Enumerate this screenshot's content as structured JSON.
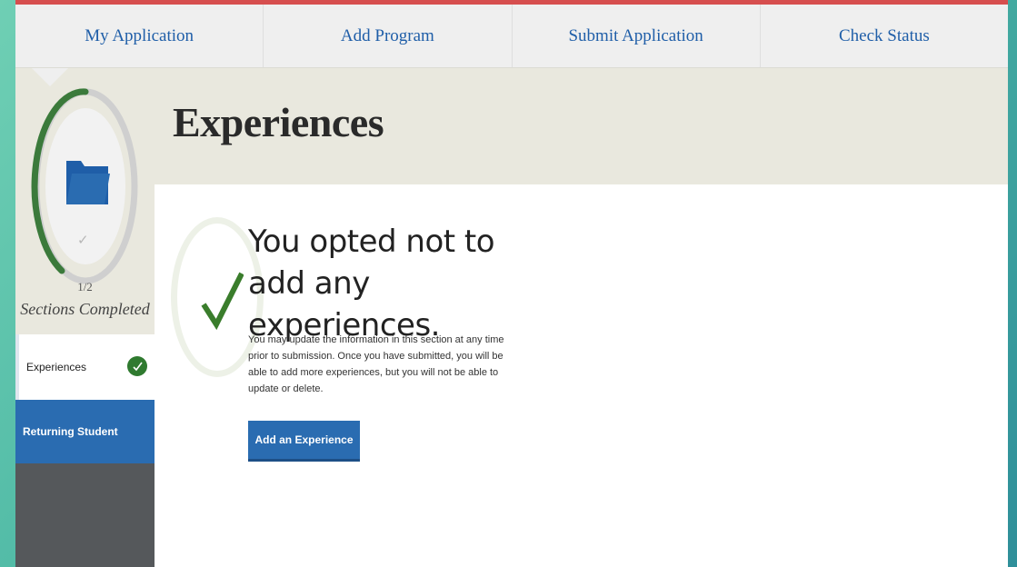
{
  "nav": {
    "tabs": [
      {
        "label": "My Application"
      },
      {
        "label": "Add Program"
      },
      {
        "label": "Submit Application"
      },
      {
        "label": "Check Status"
      }
    ]
  },
  "sidebar": {
    "progress_count": "1/2",
    "progress_caption": "Sections Completed",
    "items": [
      {
        "label": "Experiences",
        "completed": true
      },
      {
        "label": "Returning Student",
        "active": true
      }
    ]
  },
  "page": {
    "title": "Experiences",
    "headline": "You opted not to add any experiences.",
    "body": "You may update the information in this section at any time prior to submission. Once you have submitted, you will be able to add more experiences, but you will not be able to update or delete.",
    "add_button": "Add an Experience"
  },
  "colors": {
    "brand_blue": "#2a6cb1",
    "nav_text": "#1f5ea8",
    "success_green": "#2f7a2f",
    "header_band": "#e9e8de",
    "sidebar_dark": "#55585b"
  },
  "icons": [
    "folder-icon",
    "checkmark-icon",
    "check-badge-icon"
  ]
}
